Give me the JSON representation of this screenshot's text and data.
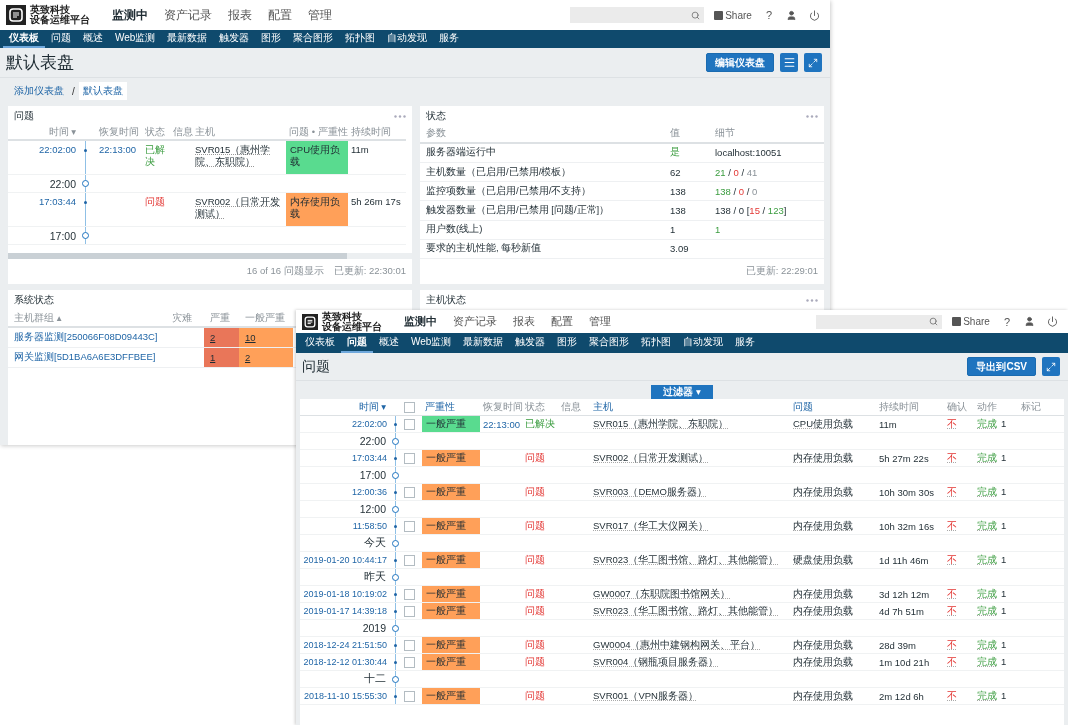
{
  "back_window": {
    "header": {
      "brand": [
        "英致科技",
        "设备运维平台"
      ],
      "menu": [
        {
          "label": "监测中",
          "selected": true
        },
        {
          "label": "资产记录",
          "selected": false
        },
        {
          "label": "报表",
          "selected": false
        },
        {
          "label": "配置",
          "selected": false
        },
        {
          "label": "管理",
          "selected": false
        }
      ],
      "share": "Share",
      "help": "?"
    },
    "subnav": [
      {
        "label": "仪表板",
        "selected": true
      },
      {
        "label": "问题",
        "selected": false
      },
      {
        "label": "概述",
        "selected": false
      },
      {
        "label": "Web监测",
        "selected": false
      },
      {
        "label": "最新数据",
        "selected": false
      },
      {
        "label": "触发器",
        "selected": false
      },
      {
        "label": "图形",
        "selected": false
      },
      {
        "label": "聚合图形",
        "selected": false
      },
      {
        "label": "拓扑图",
        "selected": false
      },
      {
        "label": "自动发现",
        "selected": false
      },
      {
        "label": "服务",
        "selected": false
      }
    ],
    "page_title": "默认表盘",
    "edit_button": "编辑仪表盘",
    "breadcrumb": [
      {
        "label": "添加仪表盘",
        "selected": false
      },
      {
        "label": "默认表盘",
        "selected": true
      }
    ],
    "breadcrumb_separator": "/",
    "problems_widget": {
      "title": "问题",
      "columns": [
        "时间 ▾",
        "恢复时间",
        "状态",
        "信息",
        "主机",
        "问题 • 严重性",
        "持续时间"
      ],
      "rows": [
        {
          "kind": "event",
          "time": "22:02:00",
          "recovery_time": "22:13:00",
          "status": "已解决",
          "resolved": true,
          "host": "SVR015（惠州学院、东职院）",
          "problem": "CPU使用负载",
          "color": "#59db8f",
          "duration": "11m"
        },
        {
          "kind": "divider",
          "label": "22:00"
        },
        {
          "kind": "event",
          "time": "17:03:44",
          "status": "问题",
          "resolved": false,
          "host": "SVR002（日常开发测试）",
          "problem": "内存使用负载",
          "color": "#ffa059",
          "duration": "5h 26m 17s"
        },
        {
          "kind": "divider",
          "label": "17:00"
        }
      ],
      "footer_count": "16 of 16 问题显示",
      "footer_updated": "已更新: 22:30:01"
    },
    "status_widget": {
      "title": "状态",
      "columns": [
        "参数",
        "值",
        "细节"
      ],
      "rows": [
        {
          "parameter": "服务器端运行中",
          "value": {
            "text": "是",
            "good": true
          },
          "details": [
            {
              "text": "localhost:10051",
              "good": false,
              "bad": false,
              "dim": false
            }
          ]
        },
        {
          "parameter": "主机数量（已启用/已禁用/模板）",
          "value": {
            "text": "62",
            "good": false
          },
          "details": [
            {
              "text": "21",
              "good": true,
              "bad": false,
              "dim": false
            },
            {
              "text": " / ",
              "good": false,
              "bad": false,
              "dim": false
            },
            {
              "text": "0",
              "good": false,
              "bad": true,
              "dim": false
            },
            {
              "text": " / ",
              "good": false,
              "bad": false,
              "dim": false
            },
            {
              "text": "41",
              "good": false,
              "bad": false,
              "dim": true
            }
          ]
        },
        {
          "parameter": "监控项数量（已启用/已禁用/不支持）",
          "value": {
            "text": "138",
            "good": false
          },
          "details": [
            {
              "text": "138",
              "good": true,
              "bad": false,
              "dim": false
            },
            {
              "text": " / ",
              "good": false,
              "bad": false,
              "dim": false
            },
            {
              "text": "0",
              "good": false,
              "bad": true,
              "dim": false
            },
            {
              "text": " / ",
              "good": false,
              "bad": false,
              "dim": false
            },
            {
              "text": "0",
              "good": false,
              "bad": false,
              "dim": true
            }
          ]
        },
        {
          "parameter": "触发器数量（已启用/已禁用 [问题/正常]）",
          "value": {
            "text": "138",
            "good": false
          },
          "details": [
            {
              "text": "138 / 0 [",
              "good": false,
              "bad": false,
              "dim": false
            },
            {
              "text": "15",
              "good": false,
              "bad": true,
              "dim": false
            },
            {
              "text": " / ",
              "good": false,
              "bad": false,
              "dim": false
            },
            {
              "text": "123",
              "good": true,
              "bad": false,
              "dim": false
            },
            {
              "text": "]",
              "good": false,
              "bad": false,
              "dim": false
            }
          ]
        },
        {
          "parameter": "用户数(线上)",
          "value": {
            "text": "1",
            "good": false
          },
          "details": [
            {
              "text": "1",
              "good": true,
              "bad": false,
              "dim": false
            }
          ]
        },
        {
          "parameter": "要求的主机性能, 每秒新值",
          "value": {
            "text": "3.09",
            "good": false
          },
          "details": []
        }
      ],
      "footer_updated": "已更新: 22:29:01"
    },
    "system_status_widget": {
      "title": "系统状态",
      "columns": [
        "主机群组 ▴",
        "灾难",
        "严重",
        "一般严重"
      ],
      "rows": [
        {
          "group": "服务器监测[250066F08D09443C]",
          "cells": [
            {
              "text": "2",
              "color": "#e97659"
            },
            {
              "text": "10",
              "color": "#ffa059"
            }
          ]
        },
        {
          "group": "网关监测[5D1BA6A6E3DFFBEE]",
          "cells": [
            {
              "text": "1",
              "color": "#e97659"
            },
            {
              "text": "2",
              "color": "#ffa059"
            }
          ]
        }
      ]
    },
    "host_status_widget": {
      "title": "主机状态"
    }
  },
  "front_window": {
    "header": {
      "brand": [
        "英致科技",
        "设备运维平台"
      ],
      "menu": [
        {
          "label": "监测中",
          "selected": true
        },
        {
          "label": "资产记录",
          "selected": false
        },
        {
          "label": "报表",
          "selected": false
        },
        {
          "label": "配置",
          "selected": false
        },
        {
          "label": "管理",
          "selected": false
        }
      ],
      "share": "Share",
      "help": "?"
    },
    "subnav": [
      {
        "label": "仪表板",
        "selected": false
      },
      {
        "label": "问题",
        "selected": true
      },
      {
        "label": "概述",
        "selected": false
      },
      {
        "label": "Web监测",
        "selected": false
      },
      {
        "label": "最新数据",
        "selected": false
      },
      {
        "label": "触发器",
        "selected": false
      },
      {
        "label": "图形",
        "selected": false
      },
      {
        "label": "聚合图形",
        "selected": false
      },
      {
        "label": "拓扑图",
        "selected": false
      },
      {
        "label": "自动发现",
        "selected": false
      },
      {
        "label": "服务",
        "selected": false
      }
    ],
    "page_title": "问题",
    "export_button": "导出到CSV",
    "filter_button": "过滤器 ▾",
    "columns": [
      {
        "label": "时间 ▾",
        "sortable": true
      },
      {
        "label": "严重性",
        "sortable": true
      },
      {
        "label": "恢复时间",
        "sortable": false
      },
      {
        "label": "状态",
        "sortable": false
      },
      {
        "label": "信息",
        "sortable": false
      },
      {
        "label": "主机",
        "sortable": true
      },
      {
        "label": "问题",
        "sortable": true
      },
      {
        "label": "持续时间",
        "sortable": false
      },
      {
        "label": "确认",
        "sortable": false
      },
      {
        "label": "动作",
        "sortable": false
      },
      {
        "label": "标记",
        "sortable": false
      }
    ],
    "select_all_checked": false,
    "rows": [
      {
        "kind": "event",
        "time": "22:02:00",
        "checked": false,
        "severity": "一般严重",
        "color": "#59db8f",
        "recovery_time": "22:13:00",
        "status": "已解决",
        "resolved": true,
        "host": "SVR015（惠州学院、东职院）",
        "problem": "CPU使用负载",
        "duration": "11m",
        "ack": "不",
        "action": "完成",
        "action_count": "1"
      },
      {
        "kind": "divider",
        "label": "22:00"
      },
      {
        "kind": "event",
        "time": "17:03:44",
        "checked": false,
        "severity": "一般严重",
        "color": "#ffa059",
        "status": "问题",
        "resolved": false,
        "host": "SVR002（日常开发测试）",
        "problem": "内存使用负载",
        "duration": "5h 27m 22s",
        "ack": "不",
        "action": "完成",
        "action_count": "1"
      },
      {
        "kind": "divider",
        "label": "17:00"
      },
      {
        "kind": "event",
        "time": "12:00:36",
        "checked": false,
        "severity": "一般严重",
        "color": "#ffa059",
        "status": "问题",
        "resolved": false,
        "host": "SVR003（DEMO服务器）",
        "problem": "内存使用负载",
        "duration": "10h 30m 30s",
        "ack": "不",
        "action": "完成",
        "action_count": "1"
      },
      {
        "kind": "divider",
        "label": "12:00"
      },
      {
        "kind": "event",
        "time": "11:58:50",
        "checked": false,
        "severity": "一般严重",
        "color": "#ffa059",
        "status": "问题",
        "resolved": false,
        "host": "SVR017（华工大仪网关）",
        "problem": "内存使用负载",
        "duration": "10h 32m 16s",
        "ack": "不",
        "action": "完成",
        "action_count": "1"
      },
      {
        "kind": "divider",
        "label": "今天"
      },
      {
        "kind": "event",
        "time": "2019-01-20 10:44:17",
        "checked": false,
        "severity": "一般严重",
        "color": "#ffa059",
        "status": "问题",
        "resolved": false,
        "host": "SVR023（华工图书馆、路灯、其他能管）",
        "problem": "硬盘使用负载",
        "duration": "1d 11h 46m",
        "ack": "不",
        "action": "完成",
        "action_count": "1"
      },
      {
        "kind": "divider",
        "label": "昨天"
      },
      {
        "kind": "event",
        "time": "2019-01-18 10:19:02",
        "checked": false,
        "severity": "一般严重",
        "color": "#ffa059",
        "status": "问题",
        "resolved": false,
        "host": "GW0007（东职院图书馆网关）",
        "problem": "内存使用负载",
        "duration": "3d 12h 12m",
        "ack": "不",
        "action": "完成",
        "action_count": "1"
      },
      {
        "kind": "event",
        "time": "2019-01-17 14:39:18",
        "checked": false,
        "severity": "一般严重",
        "color": "#ffa059",
        "status": "问题",
        "resolved": false,
        "host": "SVR023（华工图书馆、路灯、其他能管）",
        "problem": "内存使用负载",
        "duration": "4d 7h 51m",
        "ack": "不",
        "action": "完成",
        "action_count": "1"
      },
      {
        "kind": "divider",
        "label": "2019"
      },
      {
        "kind": "event",
        "time": "2018-12-24 21:51:50",
        "checked": false,
        "severity": "一般严重",
        "color": "#ffa059",
        "status": "问题",
        "resolved": false,
        "host": "GW0004（惠州中建钢构网关、平台）",
        "problem": "内存使用负载",
        "duration": "28d 39m",
        "ack": "不",
        "action": "完成",
        "action_count": "1"
      },
      {
        "kind": "event",
        "time": "2018-12-12 01:30:44",
        "checked": false,
        "severity": "一般严重",
        "color": "#ffa059",
        "status": "问题",
        "resolved": false,
        "host": "SVR004（钢瓶项目服务器）",
        "problem": "内存使用负载",
        "duration": "1m 10d 21h",
        "ack": "不",
        "action": "完成",
        "action_count": "1"
      },
      {
        "kind": "divider",
        "label": "十二"
      },
      {
        "kind": "event",
        "time": "2018-11-10 15:55:30",
        "checked": false,
        "severity": "一般严重",
        "color": "#ffa059",
        "status": "问题",
        "resolved": false,
        "host": "SVR001（VPN服务器）",
        "problem": "内存使用负载",
        "duration": "2m 12d 6h",
        "ack": "不",
        "action": "完成",
        "action_count": "1"
      }
    ]
  }
}
